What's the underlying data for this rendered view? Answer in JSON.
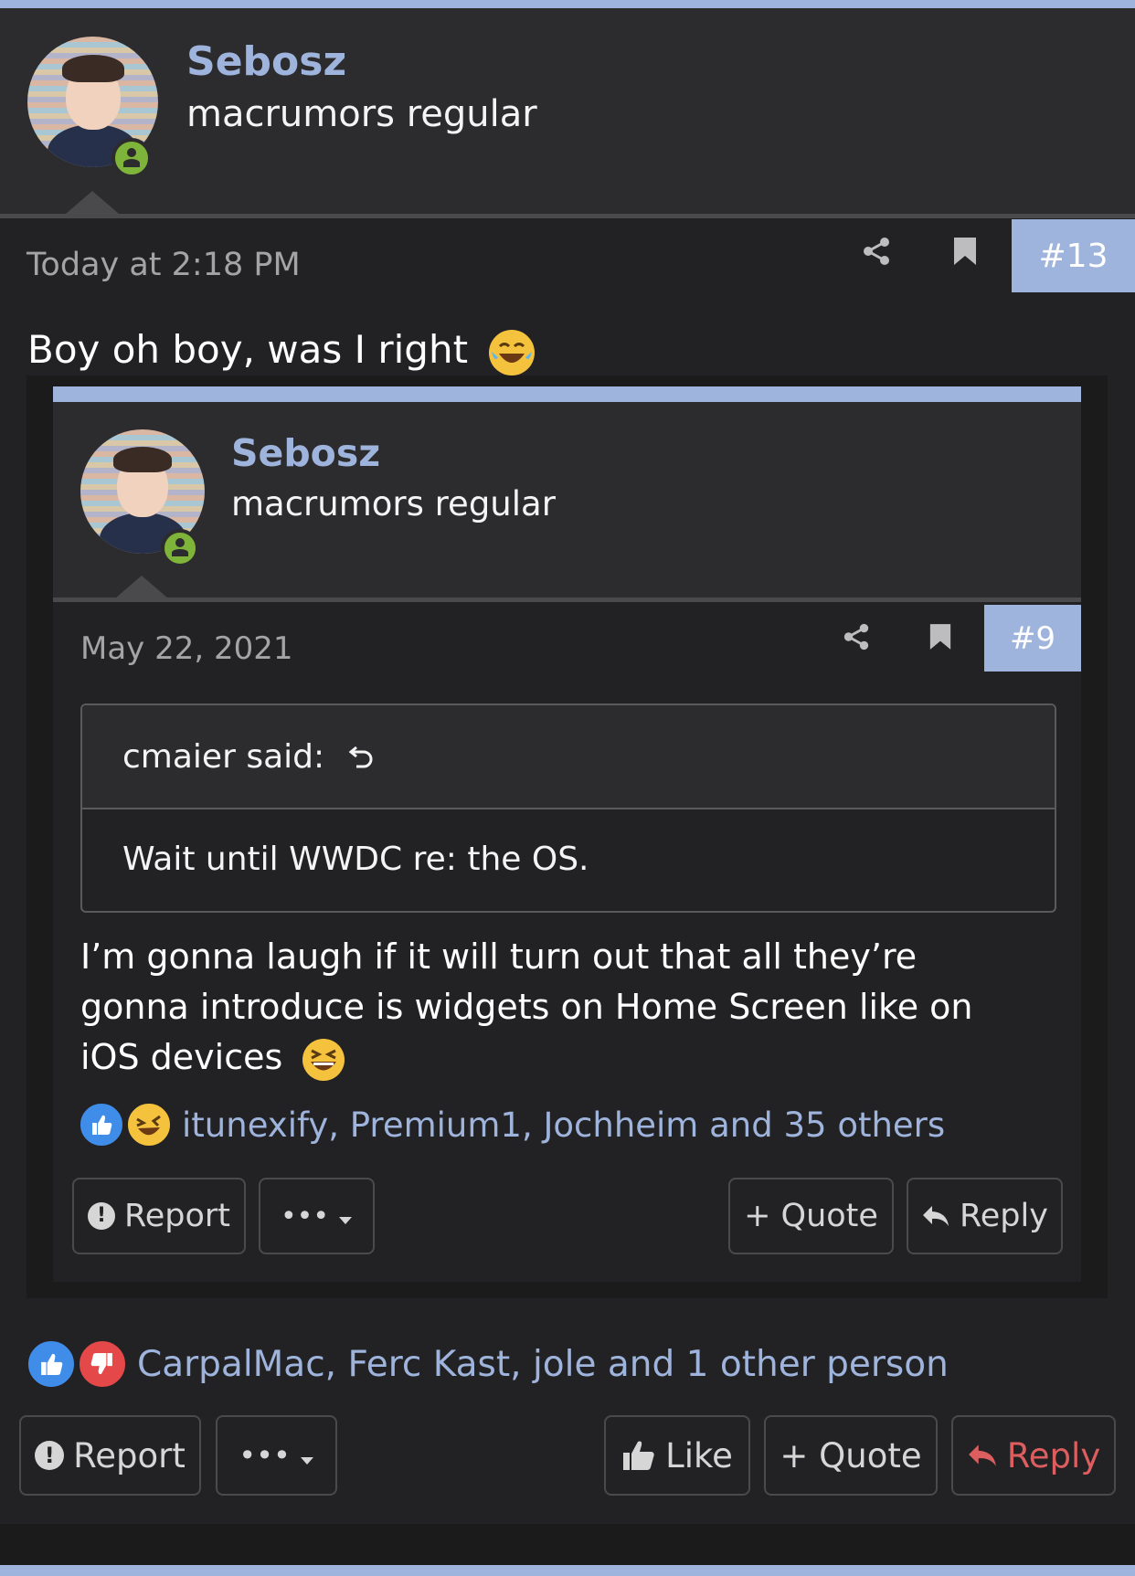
{
  "post": {
    "user": {
      "name": "Sebosz",
      "title": "macrumors regular"
    },
    "date": "Today at 2:18 PM",
    "number": "#13",
    "text": "Boy oh boy, was I right",
    "reactions": {
      "text": "CarpalMac, Ferc Kast, jole and 1 other person",
      "types": [
        "like",
        "dislike"
      ]
    },
    "actions": {
      "report": "Report",
      "more": "•••",
      "like": "Like",
      "quote": "+ Quote",
      "reply": "Reply"
    }
  },
  "quoted_post": {
    "user": {
      "name": "Sebosz",
      "title": "macrumors regular"
    },
    "date": "May 22, 2021",
    "number": "#9",
    "blockquote": {
      "attribution": "cmaier said:",
      "text": "Wait until WWDC re: the OS."
    },
    "text_lines": [
      "I’m gonna laugh if it will turn out that all they’re",
      "gonna introduce is widgets on Home Screen like on",
      "iOS devices"
    ],
    "reactions": {
      "text": "itunexify, Premium1, Jochheim and 35 others",
      "types": [
        "like",
        "haha"
      ]
    },
    "actions": {
      "report": "Report",
      "more": "•••",
      "quote": "+ Quote",
      "reply": "Reply"
    }
  },
  "colors": {
    "accent": "#9fb4dc",
    "background": "#222224",
    "header": "#2c2c2e",
    "online": "#7fb43a",
    "like": "#3f8de8",
    "dislike": "#e54848",
    "reply_red": "#dd5e5e"
  },
  "icons": [
    "share-icon",
    "bookmark-icon",
    "online-status-icon",
    "reply-arrow-icon",
    "exclamation-icon",
    "thumbs-up-icon",
    "chevron-down-icon",
    "undo-arrow-icon"
  ]
}
